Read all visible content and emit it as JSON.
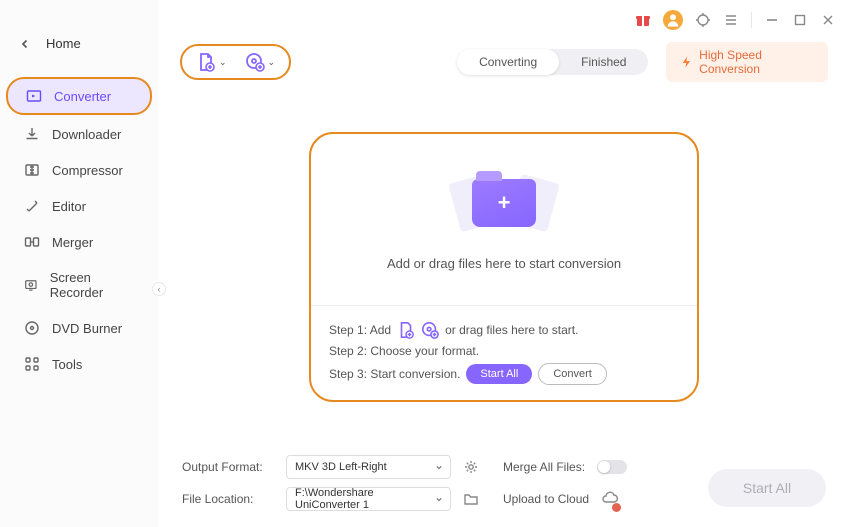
{
  "sidebar": {
    "home": "Home",
    "items": [
      {
        "label": "Converter"
      },
      {
        "label": "Downloader"
      },
      {
        "label": "Compressor"
      },
      {
        "label": "Editor"
      },
      {
        "label": "Merger"
      },
      {
        "label": "Screen Recorder"
      },
      {
        "label": "DVD Burner"
      },
      {
        "label": "Tools"
      }
    ]
  },
  "tabs": {
    "converting": "Converting",
    "finished": "Finished"
  },
  "highspeed": "High Speed Conversion",
  "drop": {
    "main_text": "Add or drag files here to start conversion",
    "step1_prefix": "Step 1: Add",
    "step1_suffix": "or drag files here to start.",
    "step2": "Step 2: Choose your format.",
    "step3": "Step 3: Start conversion.",
    "start_all": "Start All",
    "convert": "Convert"
  },
  "bottom": {
    "output_label": "Output Format:",
    "output_value": "MKV 3D Left-Right",
    "merge_label": "Merge All Files:",
    "location_label": "File Location:",
    "location_value": "F:\\Wondershare UniConverter 1",
    "upload_label": "Upload to Cloud",
    "start_all": "Start All"
  }
}
